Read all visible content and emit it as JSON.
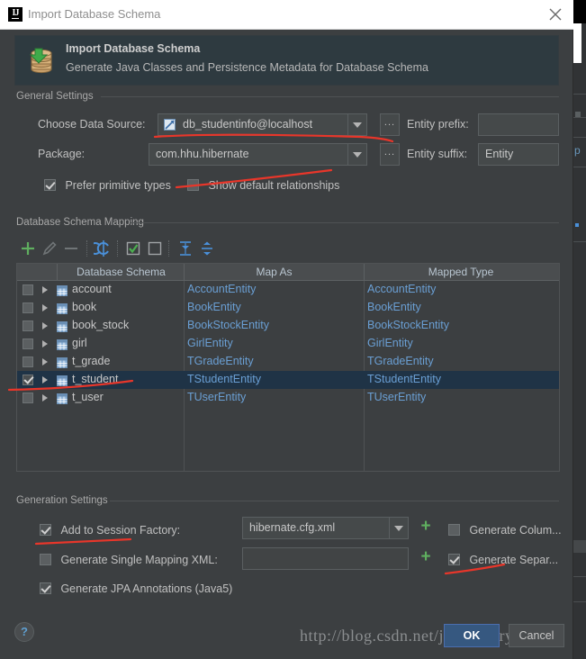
{
  "window": {
    "title": "Import Database Schema",
    "logo_text": "IJ",
    "close_icon": "close-icon"
  },
  "banner": {
    "icon": "database-import-icon",
    "title": "Import Database Schema",
    "subtitle": "Generate Java Classes and Persistence Metadata for Database Schema"
  },
  "general_settings": {
    "group_label": "General Settings",
    "data_source_label": "Choose Data Source:",
    "data_source_value": "db_studentinfo@localhost",
    "data_source_icon": "datasource-icon",
    "package_label": "Package:",
    "package_value": "com.hhu.hibernate",
    "entity_prefix_label": "Entity prefix:",
    "entity_prefix_value": "",
    "entity_suffix_label": "Entity suffix:",
    "entity_suffix_value": "Entity",
    "ellipsis_label": "...",
    "prefer_primitive_label": "Prefer primitive types",
    "prefer_primitive_checked": true,
    "show_default_rel_label": "Show default relationships",
    "show_default_rel_checked": false
  },
  "schema_mapping": {
    "group_label": "Database Schema Mapping",
    "toolbar": [
      {
        "name": "add-button",
        "glyph": "+",
        "color": "#5faf5f",
        "enabled": true
      },
      {
        "name": "edit-button",
        "glyph": "pencil",
        "color": "#6a6f71",
        "enabled": false
      },
      {
        "name": "remove-button",
        "glyph": "−",
        "color": "#6a6f71",
        "enabled": false
      },
      {
        "name": "refresh-button",
        "glyph": "refresh",
        "color": "#4a90d9",
        "enabled": true
      },
      {
        "name": "select-all-button",
        "glyph": "check-box",
        "color": "#5faf5f",
        "enabled": true
      },
      {
        "name": "deselect-all-button",
        "glyph": "empty-box",
        "color": "#a0a4a6",
        "enabled": true
      },
      {
        "name": "expand-all-button",
        "glyph": "expand",
        "color": "#4a90d9",
        "enabled": true
      },
      {
        "name": "collapse-all-button",
        "glyph": "collapse",
        "color": "#4a90d9",
        "enabled": true
      }
    ],
    "columns": [
      "",
      "Database Schema",
      "Map As",
      "Mapped Type"
    ],
    "rows": [
      {
        "checked": false,
        "selected": false,
        "schema": "account",
        "map_as": "AccountEntity",
        "mapped_type": "AccountEntity"
      },
      {
        "checked": false,
        "selected": false,
        "schema": "book",
        "map_as": "BookEntity",
        "mapped_type": "BookEntity"
      },
      {
        "checked": false,
        "selected": false,
        "schema": "book_stock",
        "map_as": "BookStockEntity",
        "mapped_type": "BookStockEntity"
      },
      {
        "checked": false,
        "selected": false,
        "schema": "girl",
        "map_as": "GirlEntity",
        "mapped_type": "GirlEntity"
      },
      {
        "checked": false,
        "selected": false,
        "schema": "t_grade",
        "map_as": "TGradeEntity",
        "mapped_type": "TGradeEntity"
      },
      {
        "checked": true,
        "selected": true,
        "schema": "t_student",
        "map_as": "TStudentEntity",
        "mapped_type": "TStudentEntity"
      },
      {
        "checked": false,
        "selected": false,
        "schema": "t_user",
        "map_as": "TUserEntity",
        "mapped_type": "TUserEntity"
      }
    ]
  },
  "generation_settings": {
    "group_label": "Generation Settings",
    "add_session_factory_label": "Add to Session Factory:",
    "add_session_factory_checked": true,
    "session_factory_value": "hibernate.cfg.xml",
    "generate_single_mapping_label": "Generate Single Mapping XML:",
    "generate_single_mapping_checked": false,
    "single_mapping_value": "",
    "generate_jpa_label": "Generate JPA Annotations (Java5)",
    "generate_jpa_checked": true,
    "generate_columns_label": "Generate Colum...",
    "generate_columns_checked": false,
    "generate_separate_label": "Generate Separ...",
    "generate_separate_checked": true,
    "plus_glyph": "+"
  },
  "footer": {
    "help_label": "?",
    "ok_label": "OK",
    "cancel_label": "Cancel",
    "watermark": "http://blog.csdn.net/jacksonary"
  },
  "colors": {
    "dialog_bg": "#3c3f41",
    "titlebar_bg": "#ffffff",
    "banner_bg": "#2e3a40",
    "accent_blue": "#6a9fd4",
    "selection_blue": "#1f3346",
    "primary_button": "#365880",
    "annotation_red": "#e8362a",
    "green": "#5faf5f"
  }
}
